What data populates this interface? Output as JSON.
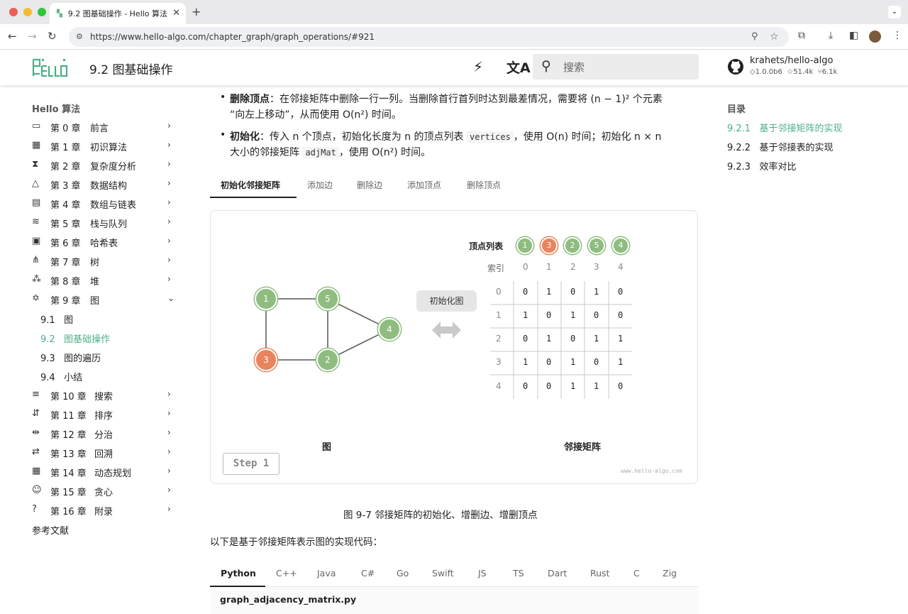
{
  "browser": {
    "tab_title": "9.2 图基础操作 - Hello 算法",
    "tab_favicon": "hello-algo-logo",
    "url": "https://www.hello-algo.com/chapter_graph/graph_operations/#921"
  },
  "header": {
    "page_title": "9.2   图基础操作",
    "search_placeholder": "搜索",
    "repo_name": "krahets/hello-algo",
    "version": "1.0.0b6",
    "stars": "51.4k",
    "forks": "6.1k"
  },
  "sidebar": {
    "title": "Hello 算法",
    "chapters": [
      {
        "num": "第 0 章",
        "label": "前言",
        "icon": "book-icon"
      },
      {
        "num": "第 1 章",
        "label": "初识算法",
        "icon": "calculator-icon"
      },
      {
        "num": "第 2 章",
        "label": "复杂度分析",
        "icon": "hourglass-icon"
      },
      {
        "num": "第 3 章",
        "label": "数据结构",
        "icon": "shapes-icon"
      },
      {
        "num": "第 4 章",
        "label": "数组与链表",
        "icon": "table-icon"
      },
      {
        "num": "第 5 章",
        "label": "栈与队列",
        "icon": "stack-icon"
      },
      {
        "num": "第 6 章",
        "label": "哈希表",
        "icon": "table-search-icon"
      },
      {
        "num": "第 7 章",
        "label": "树",
        "icon": "tree-icon"
      },
      {
        "num": "第 8 章",
        "label": "堆",
        "icon": "heap-icon"
      },
      {
        "num": "第 9 章",
        "label": "图",
        "icon": "graph-icon"
      }
    ],
    "sub_items": [
      {
        "num": "9.1",
        "label": "图"
      },
      {
        "num": "9.2",
        "label": "图基础操作"
      },
      {
        "num": "9.3",
        "label": "图的遍历"
      },
      {
        "num": "9.4",
        "label": "小结"
      }
    ],
    "chapters2": [
      {
        "num": "第 10 章",
        "label": "搜索",
        "icon": "search-list-icon"
      },
      {
        "num": "第 11 章",
        "label": "排序",
        "icon": "sort-icon"
      },
      {
        "num": "第 12 章",
        "label": "分治",
        "icon": "divide-icon"
      },
      {
        "num": "第 13 章",
        "label": "回溯",
        "icon": "backtrack-icon"
      },
      {
        "num": "第 14 章",
        "label": "动态规划",
        "icon": "grid-icon"
      },
      {
        "num": "第 15 章",
        "label": "贪心",
        "icon": "head-icon"
      },
      {
        "num": "第 16 章",
        "label": "附录",
        "icon": "help-circle-icon"
      }
    ],
    "references": "参考文献"
  },
  "toc": {
    "title": "目录",
    "items": [
      {
        "num": "9.2.1",
        "label": "基于邻接矩阵的实现"
      },
      {
        "num": "9.2.2",
        "label": "基于邻接表的实现"
      },
      {
        "num": "9.2.3",
        "label": "效率对比"
      }
    ]
  },
  "content": {
    "bullet1_bold": "删除顶点",
    "bullet1_a": "：在邻接矩阵中删除一行一列。当删除首行首列时达到最差情况，需要将 (n − 1)² 个元素",
    "bullet1_b": "“向左上移动”，从而使用 O(n²) 时间。",
    "bullet2_bold": "初始化",
    "bullet2_a": "：传入 n 个顶点，初始化长度为 n 的顶点列表",
    "bullet2_code1": "vertices",
    "bullet2_b": "，使用 O(n) 时间；初始化 n × n",
    "bullet2_c": "大小的邻接矩阵",
    "bullet2_code2": "adjMat",
    "bullet2_d": "，使用 O(n²) 时间。",
    "tabs": [
      "初始化邻接矩阵",
      "添加边",
      "删除边",
      "添加顶点",
      "删除顶点"
    ],
    "figure": {
      "vertex_list_label": "顶点列表",
      "vertex_list": [
        "1",
        "3",
        "2",
        "5",
        "4"
      ],
      "index_label": "索引",
      "indices": [
        "0",
        "1",
        "2",
        "3",
        "4"
      ],
      "matrix": [
        [
          "0",
          "1",
          "0",
          "1",
          "0"
        ],
        [
          "1",
          "0",
          "1",
          "0",
          "0"
        ],
        [
          "0",
          "1",
          "0",
          "1",
          "1"
        ],
        [
          "1",
          "0",
          "1",
          "0",
          "1"
        ],
        [
          "0",
          "0",
          "1",
          "1",
          "0"
        ]
      ],
      "init_button": "初始化图",
      "graph_label": "图",
      "matrix_label": "邻接矩阵",
      "step": "Step 1",
      "watermark": "www.hello-algo.com",
      "nodes": [
        "1",
        "5",
        "4",
        "3",
        "2"
      ]
    },
    "caption": "图 9-7   邻接矩阵的初始化、增删边、增删顶点",
    "code_intro": "以下是基于邻接矩阵表示图的实现代码：",
    "lang_tabs": [
      "Python",
      "C++",
      "Java",
      "C#",
      "Go",
      "Swift",
      "JS",
      "TS",
      "Dart",
      "Rust",
      "C",
      "Zig"
    ],
    "code_filename": "graph_adjacency_matrix.py"
  },
  "colors": {
    "accent": "#4caf88",
    "green_node": "#8fbd80",
    "orange_node": "#e9845e",
    "active_sidebar": "#4caf88"
  }
}
